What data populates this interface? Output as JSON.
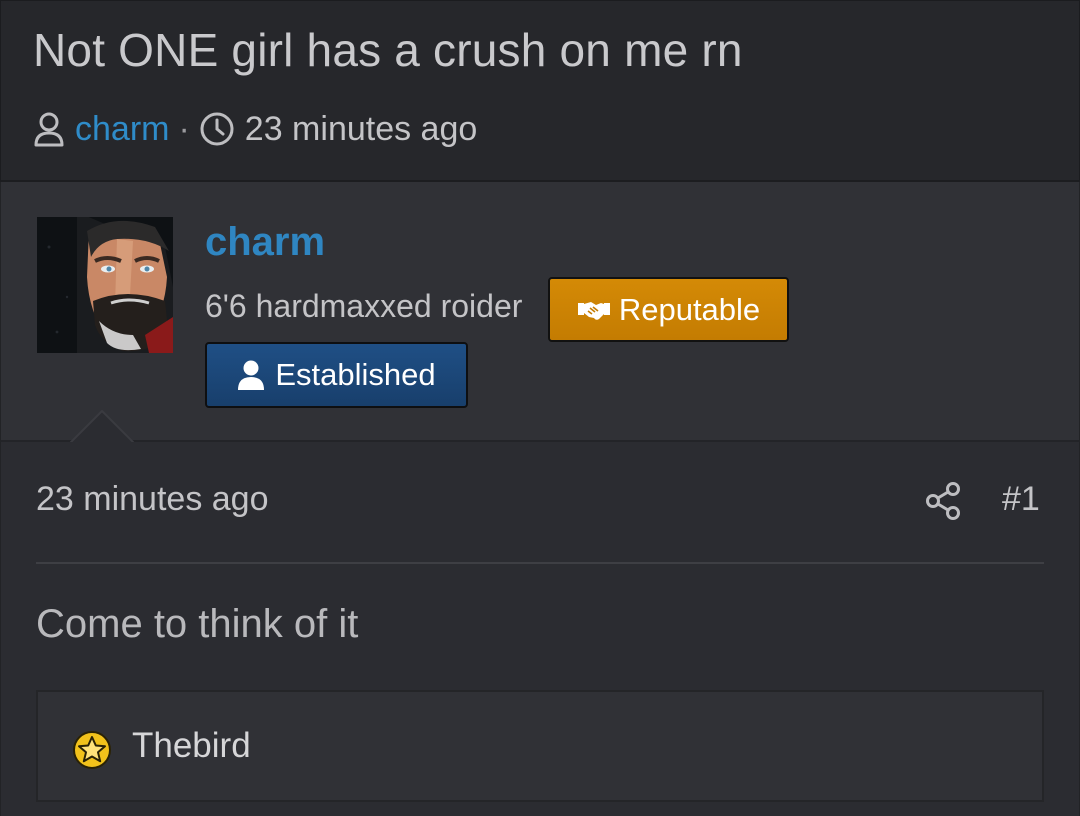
{
  "thread": {
    "title": "Not ONE girl has a crush on me rn",
    "author": "charm",
    "separator": "·",
    "time": "23 minutes ago",
    "icons": [
      "user-icon",
      "clock-icon"
    ]
  },
  "message": {
    "user": {
      "name": "charm",
      "title": "6'6 hardmaxxed roider",
      "avatar_icon": "avatar-image",
      "badges": [
        {
          "label": "Reputable",
          "icon": "handshake-icon",
          "color": "#d08704"
        },
        {
          "label": "Established",
          "icon": "user-icon",
          "color": "#1d4a7c"
        }
      ]
    },
    "time": "23 minutes ago",
    "number": "#1",
    "share_icon": "share-icon",
    "text": "Come to think of it",
    "reactions": {
      "icon": "star-reaction-icon",
      "users": "Thebird"
    }
  },
  "colors": {
    "link": "#2f8cc9",
    "background": "#2b2c31",
    "header_background": "#26272b"
  }
}
